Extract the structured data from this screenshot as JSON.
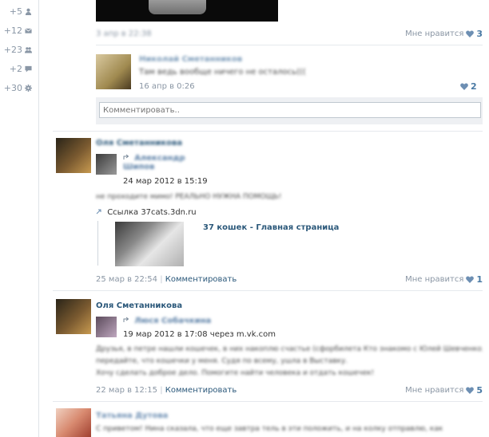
{
  "sidebar": {
    "items": [
      {
        "count": "+5",
        "icon": "person-icon"
      },
      {
        "count": "+12",
        "icon": "envelope-icon"
      },
      {
        "count": "+23",
        "icon": "group-icon"
      },
      {
        "count": "+2",
        "icon": "chat-bubble-icon"
      },
      {
        "count": "+30",
        "icon": "gear-icon"
      }
    ]
  },
  "top_post": {
    "date": "3 апр в 22:38",
    "likes_label": "Мне нравится",
    "likes_count": "3"
  },
  "comment": {
    "author": "Николай Сметанников",
    "text": "Там ведь вообще ничего не осталось(((",
    "date": "16 апр в 0:26",
    "likes_count": "2"
  },
  "comment_input": {
    "placeholder": "Комментировать.."
  },
  "post2": {
    "author": "Оля Сметанникова",
    "repost_author": "Александр Шипов",
    "repost_date": "24 мар 2012 в 15:19",
    "text": "не проходите мимо! РЕАЛЬНО НУЖНА ПОМОЩЬ!",
    "link_prefix": "Ссылка",
    "link_url": "37cats.3dn.ru",
    "link_title": "37 кошек - Главная страница",
    "date": "25 мар в 22:54",
    "comment_label": "Комментировать",
    "likes_label": "Мне нравится",
    "likes_count": "1"
  },
  "post3": {
    "author": "Оля Сметанникова",
    "repost_author": "Люся Собачкина",
    "repost_date": "19 мар 2012 в 17:08 через m.vk.com",
    "text_line1": "Друзья, в петре нашли кошечек, в них накоплю счастье (cфорбилета Кто знакомо с Юлей Шевченко,",
    "text_line2": "передайте, что кошечки у меня. Судя по всему, ушла в Выставку.",
    "text_line3": "Хочу сделать доброе дело. Помогите найти человека и отдать кошечек!",
    "date": "22 мар в 12:15",
    "comment_label": "Комментировать",
    "likes_label": "Мне нравится",
    "likes_count": "5"
  },
  "post4": {
    "author": "Татьяна Дутова",
    "text": "С приветом! Нина сказала, что еще завтра тель в эти положить, и на колку отправлю, как"
  }
}
